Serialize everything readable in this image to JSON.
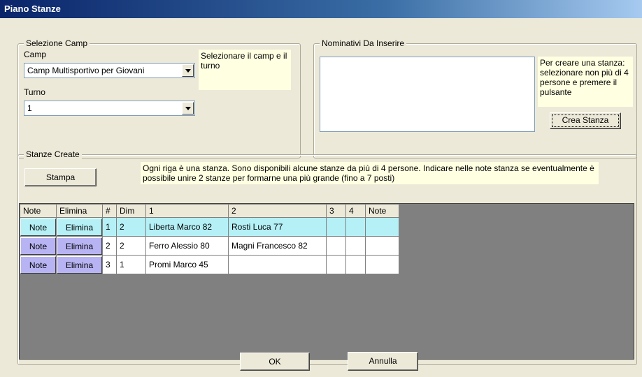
{
  "window": {
    "title": "Piano Stanze"
  },
  "selezione": {
    "legend": "Selezione Camp",
    "camp_label": "Camp",
    "camp_value": "Camp Multisportivo per Giovani",
    "turno_label": "Turno",
    "turno_value": "1",
    "hint": "Selezionare il camp e il turno"
  },
  "nominativi": {
    "legend": "Nominativi Da Inserire",
    "hint": "Per creare una stanza: selezionare non più di 4 persone e premere il pulsante",
    "crea_label": "Crea Stanza"
  },
  "stanze": {
    "legend": "Stanze Create",
    "stampa_label": "Stampa",
    "info": "Ogni riga è una stanza. Sono disponibili alcune stanze da più di 4 persone. Indicare nelle note stanza se eventualmente è possibile unire 2 stanze per formarne una più grande (fino a 7 posti)"
  },
  "grid": {
    "columns": [
      "Note",
      "Elimina",
      "#",
      "Dim",
      "1",
      "2",
      "3",
      "4",
      "Note"
    ],
    "rows": [
      {
        "note": "Note",
        "elimina": "Elimina",
        "num": "1",
        "dim": "2",
        "p1": "Liberta Marco 82",
        "p2": "Rosti Luca 77",
        "p3": "",
        "p4": "",
        "notes": ""
      },
      {
        "note": "Note",
        "elimina": "Elimina",
        "num": "2",
        "dim": "2",
        "p1": "Ferro Alessio 80",
        "p2": "Magni Francesco 82",
        "p3": "",
        "p4": "",
        "notes": ""
      },
      {
        "note": "Note",
        "elimina": "Elimina",
        "num": "3",
        "dim": "1",
        "p1": "Promi Marco 45",
        "p2": "",
        "p3": "",
        "p4": "",
        "notes": ""
      }
    ]
  },
  "footer": {
    "ok_label": "OK",
    "annulla_label": "Annulla"
  }
}
